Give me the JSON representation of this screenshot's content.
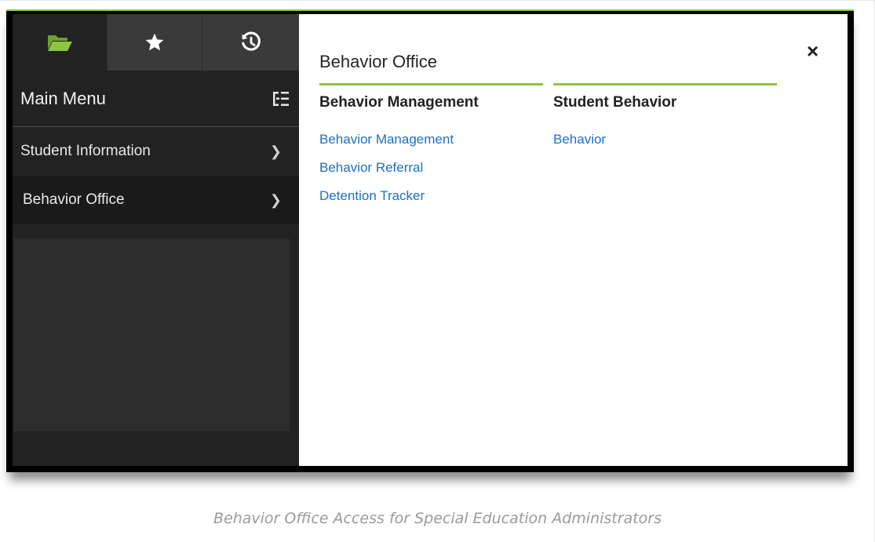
{
  "nav": {
    "tabs": [
      {
        "icon": "folder-open-icon",
        "active": true
      },
      {
        "icon": "star-icon",
        "active": false
      },
      {
        "icon": "history-icon",
        "active": false
      }
    ],
    "menu_title": "Main Menu",
    "menu_icon": "list-tree-icon",
    "items": [
      {
        "label": "Student Information",
        "active": false
      },
      {
        "label": "Behavior Office",
        "active": true
      }
    ]
  },
  "panel": {
    "title": "Behavior Office",
    "close_label": "×",
    "columns": [
      {
        "heading": "Behavior Management",
        "links": [
          "Behavior Management",
          "Behavior Referral",
          "Detention Tracker"
        ]
      },
      {
        "heading": "Student Behavior",
        "links": [
          "Behavior"
        ]
      }
    ]
  },
  "caption": "Behavior Office Access for Special Education Administrators",
  "colors": {
    "accent_green": "#8dc63f",
    "link_blue": "#1f6fbf",
    "nav_bg": "#222222"
  }
}
